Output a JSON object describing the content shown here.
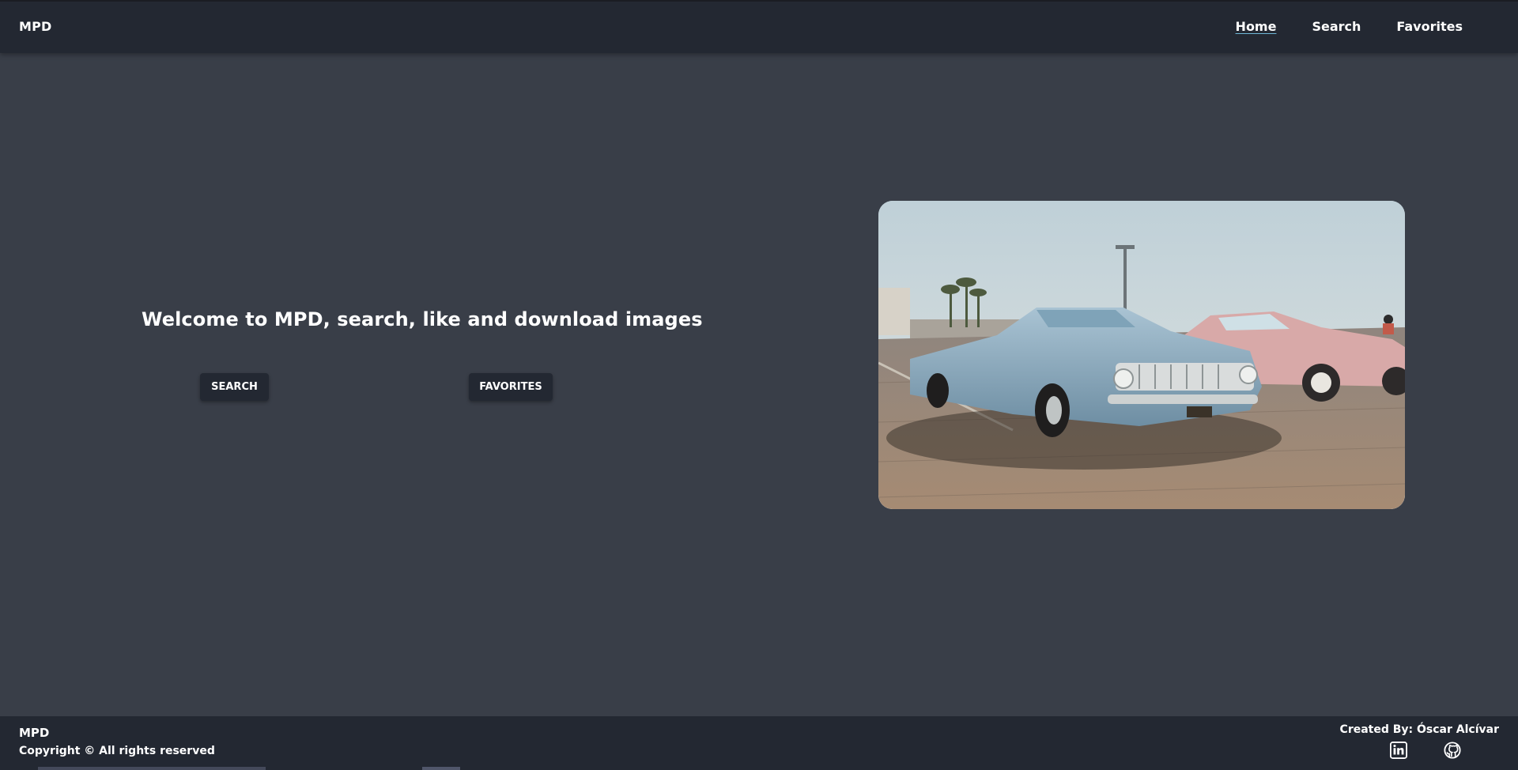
{
  "nav": {
    "brand": "MPD",
    "links": [
      {
        "label": "Home",
        "active": true
      },
      {
        "label": "Search",
        "active": false
      },
      {
        "label": "Favorites",
        "active": false
      }
    ]
  },
  "hero": {
    "heading": "Welcome to MPD, search, like and download images",
    "search_button": "SEARCH",
    "favorites_button": "FAVORITES",
    "image_icon": "vintage-cars-photo"
  },
  "footer": {
    "brand": "MPD",
    "copyright": "Copyright © All rights reserved",
    "credit": "Created By: Óscar Alcívar",
    "icons": [
      "linkedin-icon",
      "github-icon"
    ]
  },
  "colors": {
    "background": "#393e48",
    "bar": "#232832",
    "text": "#ffffff",
    "underline": "#6fb6d6"
  }
}
